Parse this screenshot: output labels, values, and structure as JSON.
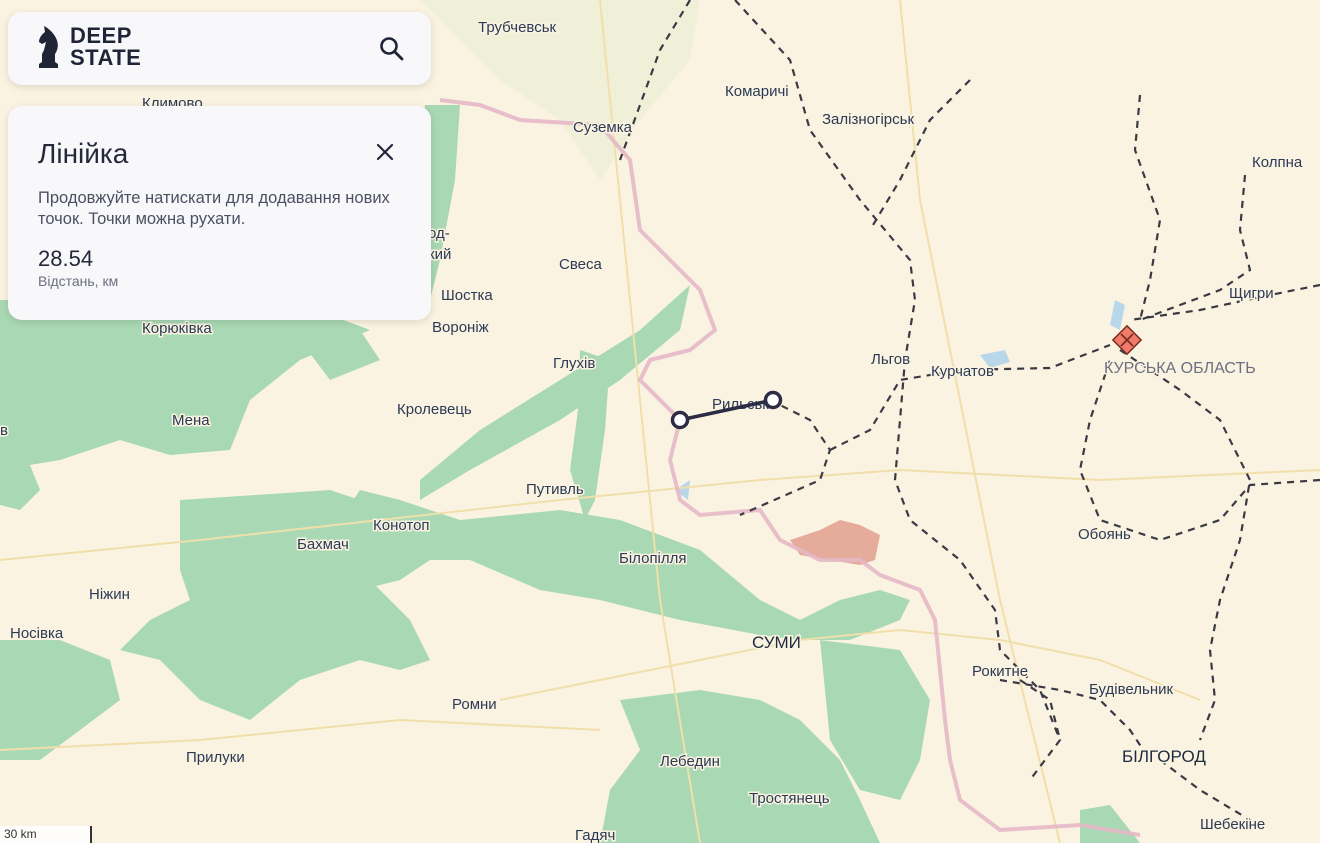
{
  "brand": {
    "line1": "DEEP",
    "line2": "STATE"
  },
  "ruler": {
    "title": "Лінійка",
    "description": "Продовжуйте натискати для додавання нових точок. Точки можна рухати.",
    "distance": "28.54",
    "unit_label": "Відстань, км"
  },
  "scale": {
    "label": "30 km"
  },
  "colors": {
    "map_bg": "#fbf3e1",
    "liberated_green": "#a9d8b4",
    "occupied_red": "#e2a393",
    "border_pink": "#e4b8c6",
    "ruler_line": "#2c2d45"
  },
  "icons": {
    "search": "search-icon",
    "close": "close-icon",
    "logo": "knight-icon"
  },
  "places": {
    "trubchevsk": "Трубчевськ",
    "klimovo": "Климово",
    "suzemka": "Суземка",
    "komarychi": "Комаричі",
    "zaliznohirsk": "Залізногірськ",
    "kolpna": "Колпна",
    "od": "од-",
    "kyi": "кий",
    "sevsk": "Свеса",
    "shostka": "Шостка",
    "voronizh": "Воронiж",
    "koriukivka": "Корюківка",
    "hlukhiv": "Глухів",
    "lgov": "Льгов",
    "kurchatov": "Курчатов",
    "shchigry": "Щигри",
    "kursk_oblast": "КУРСЬКА ОБЛАСТЬ",
    "rylsk": "Рильськ",
    "mena": "Мена",
    "krolevets": "Кролевець",
    "putyvl": "Путивль",
    "konotop": "Конотоп",
    "bakhmach": "Бахмач",
    "bilopillia": "Білопілля",
    "oboian": "Обоянь",
    "nizhyn": "Ніжин",
    "sumy": "СУМИ",
    "nosivka": "Носівка",
    "rokytne": "Рокитне",
    "budivelnyk": "Будівельник",
    "romny": "Ромни",
    "bilhorod": "БІЛГОРОД",
    "pryluky": "Прилуки",
    "lebedyn": "Лебедин",
    "trostianets": "Тростянець",
    "hadiach": "Гадяч",
    "shebekino": "Шебекіне",
    "edge_v": "в"
  }
}
